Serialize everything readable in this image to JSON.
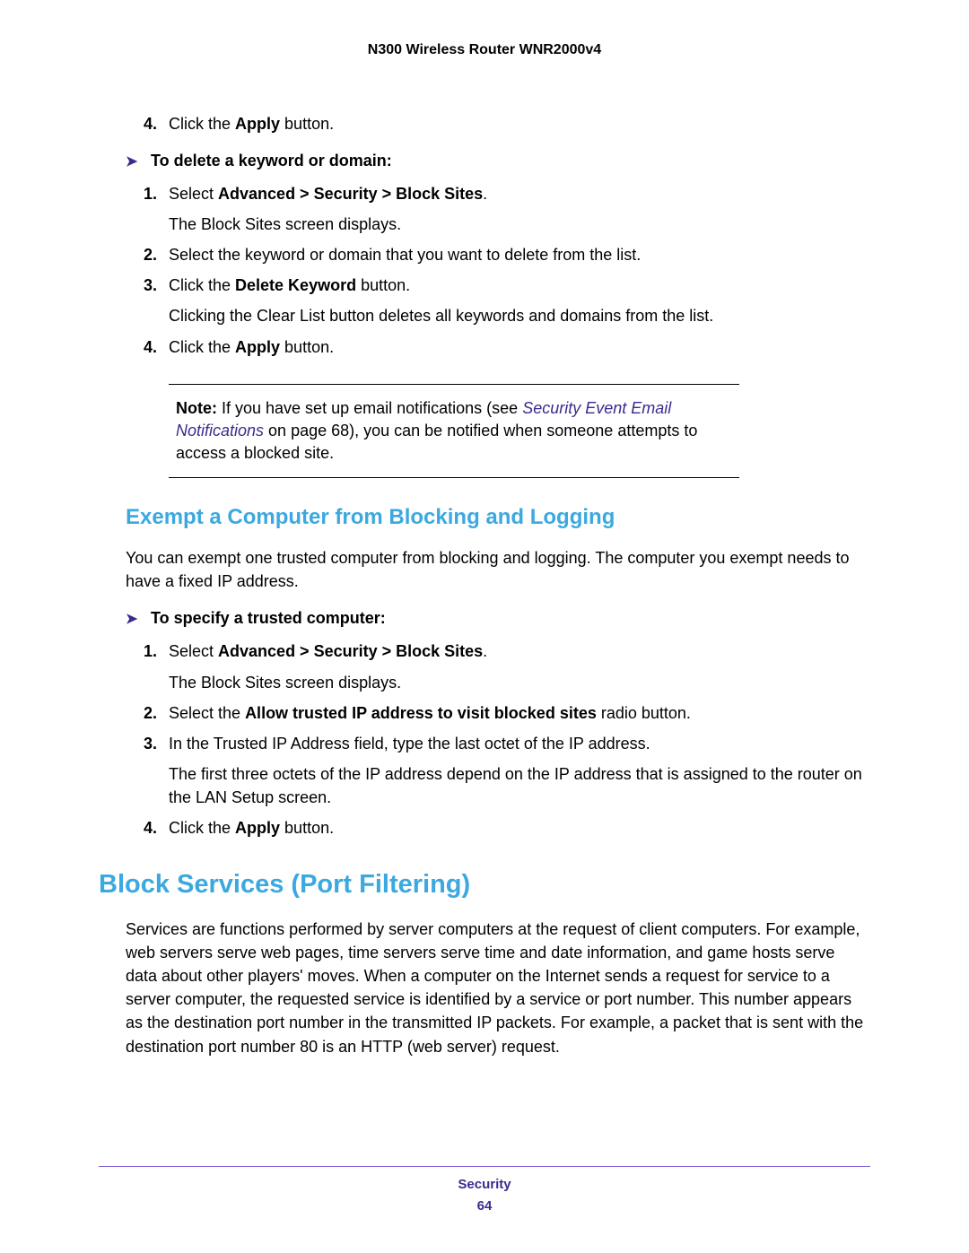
{
  "header": {
    "title": "N300 Wireless Router WNR2000v4"
  },
  "step4a": {
    "num": "4.",
    "pre": "Click the ",
    "b": "Apply",
    "post": " button."
  },
  "procDelete": {
    "title": "To delete a keyword or domain:"
  },
  "d1": {
    "num": "1.",
    "pre": "Select ",
    "b": "Advanced > Security > Block Sites",
    "post": "."
  },
  "d1sub": "The Block Sites screen displays.",
  "d2": {
    "num": "2.",
    "text": "Select the keyword or domain that you want to delete from the list."
  },
  "d3": {
    "num": "3.",
    "pre": "Click the ",
    "b": "Delete Keyword",
    "post": " button."
  },
  "d3sub": "Clicking the Clear List button deletes all keywords and domains from the list.",
  "d4": {
    "num": "4.",
    "pre": "Click the ",
    "b": "Apply",
    "post": " button."
  },
  "note": {
    "label": "Note: ",
    "pre": "If you have set up email notifications (see ",
    "link": "Security Event Email Notifications ",
    "post": "on page 68), you can be notified when someone attempts to access a blocked site."
  },
  "h2exempt": "Exempt a Computer from Blocking and Logging",
  "exemptPara": "You can exempt one trusted computer from blocking and logging. The computer you exempt needs to have a fixed IP address.",
  "procTrusted": {
    "title": "To specify a trusted computer:"
  },
  "t1": {
    "num": "1.",
    "pre": "Select ",
    "b": "Advanced > Security > Block Sites",
    "post": "."
  },
  "t1sub": "The Block Sites screen displays.",
  "t2": {
    "num": "2.",
    "pre": "Select the ",
    "b": "Allow trusted IP address to visit blocked sites",
    "post": " radio button."
  },
  "t3": {
    "num": "3.",
    "text": "In the Trusted IP Address field, type the last octet of the IP address."
  },
  "t3sub": "The first three octets of the IP address depend on the IP address that is assigned to the router on the LAN Setup screen.",
  "t4": {
    "num": "4.",
    "pre": "Click the ",
    "b": "Apply",
    "post": " button."
  },
  "h1block": "Block Services (Port Filtering)",
  "blockPara": "Services are functions performed by server computers at the request of client computers. For example, web servers serve web pages, time servers serve time and date information, and game hosts serve data about other players' moves. When a computer on the Internet sends a request for service to a server computer, the requested service is identified by a service or port number. This number appears as the destination port number in the transmitted IP packets. For example, a packet that is sent with the destination port number 80 is an HTTP (web server) request.",
  "footer": {
    "section": "Security",
    "page": "64"
  }
}
